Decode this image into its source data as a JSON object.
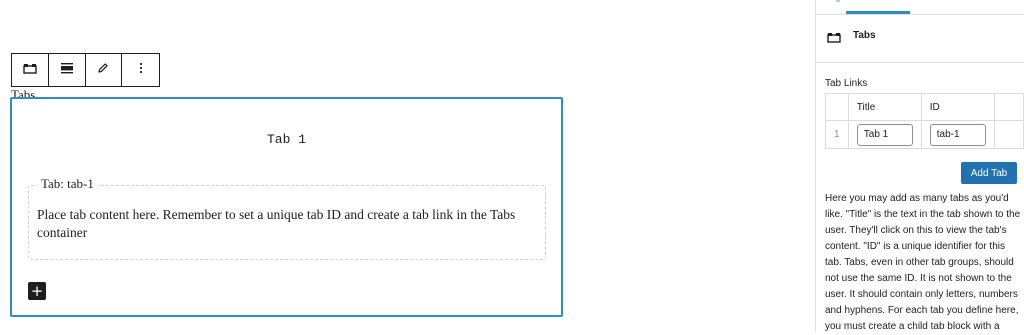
{
  "editor": {
    "block_label": "Tabs",
    "tab_link": "Tab 1",
    "tab_panel": {
      "legend": "Tab: tab-1",
      "content": "Place tab content here. Remember to set a unique tab ID and create a tab link in the Tabs container"
    },
    "add_block": "+",
    "toolbar": {
      "buttons": [
        {
          "icon": "tabs-block-icon"
        },
        {
          "icon": "align-icon"
        },
        {
          "icon": "pencil-icon"
        },
        {
          "icon": "more-options-icon"
        }
      ]
    }
  },
  "sidebar": {
    "block_title": "Tabs",
    "block_icon": "tabs-block-icon",
    "section_label": "Tab Links",
    "table": {
      "headers": [
        "Title",
        "ID"
      ],
      "rows": [
        {
          "index": "1",
          "title": "Tab 1",
          "id": "tab-1"
        }
      ]
    },
    "add_tab_label": "Add Tab",
    "help_text": "Here you may add as many tabs as you'd like. \"Title\" is the text in the tab shown to the user. They'll click on this to view the tab's content. \"ID\" is a unique identifier for this tab. Tabs, even in other tab groups, should not use the same ID. It is not shown to the user. It should contain only letters, numbers and hyphens. For each tab you define here, you must create a child tab block with a"
  },
  "colors": {
    "accent": "#2f8dc6",
    "button_primary": "#2271b1",
    "dark": "#1e1e1e"
  }
}
